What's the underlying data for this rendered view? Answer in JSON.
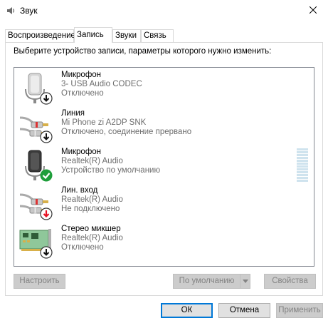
{
  "window": {
    "title": "Звук",
    "icon": "speaker-icon"
  },
  "tabs": [
    {
      "label": "Воспроизведение",
      "active": false
    },
    {
      "label": "Запись",
      "active": true
    },
    {
      "label": "Звуки",
      "active": false
    },
    {
      "label": "Связь",
      "active": false
    }
  ],
  "instruction": "Выберите устройство записи, параметры которого нужно изменить:",
  "devices": [
    {
      "name": "Микрофон",
      "device": "3- USB Audio CODEC",
      "status": "Отключено",
      "icon": "microphone-icon",
      "badge": "down-arrow-badge"
    },
    {
      "name": "Линия",
      "device": "Mi Phone zi A2DP SNK",
      "status": "Отключено, соединение прервано",
      "icon": "line-in-plug-icon",
      "badge": "down-arrow-badge"
    },
    {
      "name": "Микрофон",
      "device": "Realtek(R) Audio",
      "status": "Устройство по умолчанию",
      "icon": "microphone-icon",
      "badge": "default-check-badge"
    },
    {
      "name": "Лин. вход",
      "device": "Realtek(R) Audio",
      "status": "Не подключено",
      "icon": "line-in-plug-icon",
      "badge": "red-down-arrow-badge"
    },
    {
      "name": "Стерео микшер",
      "device": "Realtek(R) Audio",
      "status": "Отключено",
      "icon": "sound-card-icon",
      "badge": "down-arrow-badge"
    }
  ],
  "buttons": {
    "configure": "Настроить",
    "set_default": "По умолчанию",
    "properties": "Свойства",
    "ok": "ОК",
    "cancel": "Отмена",
    "apply": "Применить"
  },
  "colors": {
    "accent": "#0078d7",
    "check_green": "#1e9e3a",
    "not_connected_red": "#e81123"
  }
}
